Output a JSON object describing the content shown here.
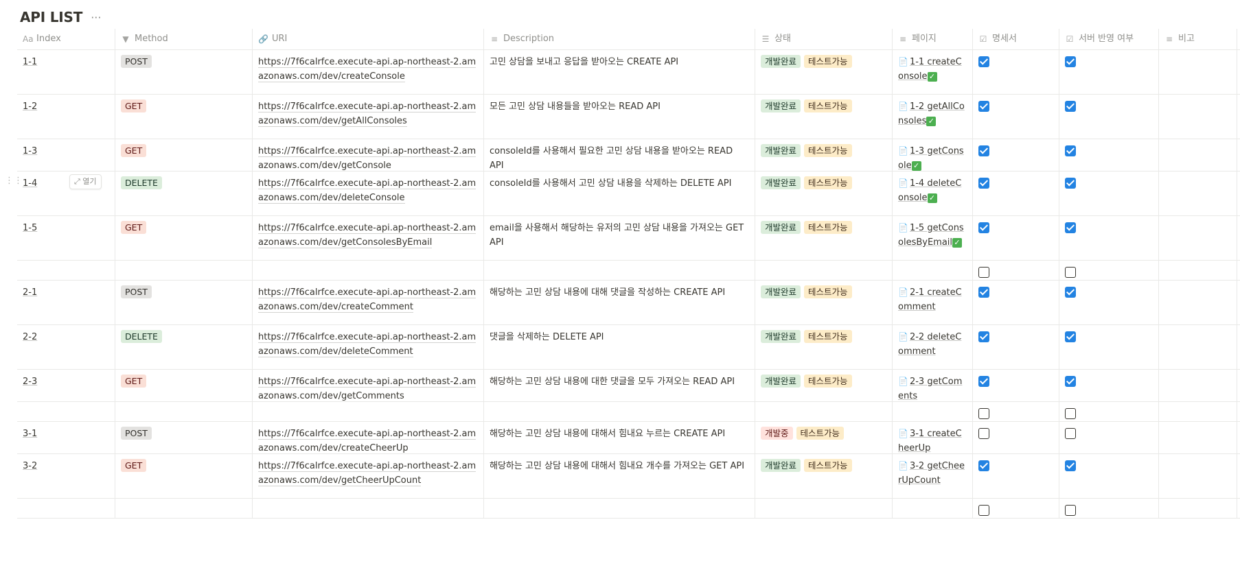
{
  "page": {
    "title": "API LIST",
    "more_icon": "more-horizontal-icon"
  },
  "columns": [
    {
      "key": "index",
      "label": "Index",
      "icon": "Aa"
    },
    {
      "key": "method",
      "label": "Method",
      "icon": "▼"
    },
    {
      "key": "uri",
      "label": "URI",
      "icon": "🔗"
    },
    {
      "key": "description",
      "label": "Description",
      "icon": "≡"
    },
    {
      "key": "status",
      "label": "상태",
      "icon": "☰"
    },
    {
      "key": "page",
      "label": "페이지",
      "icon": "≡"
    },
    {
      "key": "spec",
      "label": "명세서",
      "icon": "☑"
    },
    {
      "key": "server",
      "label": "서버 반영 여부",
      "icon": "☑"
    },
    {
      "key": "note",
      "label": "비고",
      "icon": "≡"
    }
  ],
  "open_button_label": "열기",
  "colors": {
    "accent_checkbox": "#2383e2",
    "tag_post": "#e3e2e0",
    "tag_get": "#fadfd6",
    "tag_delete": "#dbeddb",
    "status_done": "#dbeddb",
    "status_in_progress": "#ffe2dd",
    "status_testable": "#fdecc8"
  },
  "rows": [
    {
      "index": "1-1",
      "method": "POST",
      "uri": "https://7f6calrfce.execute-api.ap-northeast-2.amazonaws.com/dev/createConsole",
      "description": "고민 상담을 보내고 응답을 받아오는 CREATE API",
      "status": [
        "개발완료",
        "테스트가능"
      ],
      "page": "1-1 createConsole",
      "page_check": true,
      "spec": true,
      "server": true,
      "height": 65
    },
    {
      "index": "1-2",
      "method": "GET",
      "uri": "https://7f6calrfce.execute-api.ap-northeast-2.amazonaws.com/dev/getAllConsoles",
      "description": "모든 고민 상담 내용들을 받아오는 READ API",
      "status": [
        "개발완료",
        "테스트가능"
      ],
      "page": "1-2 getAllConsoles",
      "page_check": true,
      "spec": true,
      "server": true,
      "height": 65
    },
    {
      "index": "1-3",
      "method": "GET",
      "uri": "https://7f6calrfce.execute-api.ap-northeast-2.amazonaws.com/dev/getConsole",
      "description": "consoleId를 사용해서 필요한 고민 상담 내용을 받아오는 READ API",
      "status": [
        "개발완료",
        "테스트가능"
      ],
      "page": "1-3 getConsole",
      "page_check": true,
      "spec": true,
      "server": true,
      "height": 47
    },
    {
      "index": "1-4",
      "method": "DELETE",
      "uri": "https://7f6calrfce.execute-api.ap-northeast-2.amazonaws.com/dev/deleteConsole",
      "description": "consoleId를 사용해서 고민 상담 내용을 삭제하는 DELETE API",
      "status": [
        "개발완료",
        "테스트가능"
      ],
      "page": "1-4 deleteConsole",
      "page_check": true,
      "spec": true,
      "server": true,
      "height": 65,
      "hover": true
    },
    {
      "index": "1-5",
      "method": "GET",
      "uri": "https://7f6calrfce.execute-api.ap-northeast-2.amazonaws.com/dev/getConsolesByEmail",
      "description": "email을 사용해서 해당하는 유저의 고민 상담 내용을 가져오는 GET API",
      "status": [
        "개발완료",
        "테스트가능"
      ],
      "page": "1-5 getConsolesByEmail",
      "page_check": true,
      "spec": true,
      "server": true,
      "height": 65
    },
    {
      "index": "",
      "method": "",
      "uri": "",
      "description": "",
      "status": [],
      "page": "",
      "page_check": false,
      "spec": false,
      "server": false,
      "height": 29
    },
    {
      "index": "2-1",
      "method": "POST",
      "uri": "https://7f6calrfce.execute-api.ap-northeast-2.amazonaws.com/dev/createComment",
      "description": "해당하는 고민 상담 내용에 대해 댓글을 작성하는 CREATE API",
      "status": [
        "개발완료",
        "테스트가능"
      ],
      "page": "2-1 createComment",
      "page_check": false,
      "spec": true,
      "server": true,
      "height": 65
    },
    {
      "index": "2-2",
      "method": "DELETE",
      "uri": "https://7f6calrfce.execute-api.ap-northeast-2.amazonaws.com/dev/deleteComment",
      "description": "댓글을 삭제하는 DELETE API",
      "status": [
        "개발완료",
        "테스트가능"
      ],
      "page": "2-2 deleteComment",
      "page_check": false,
      "spec": true,
      "server": true,
      "height": 65
    },
    {
      "index": "2-3",
      "method": "GET",
      "uri": "https://7f6calrfce.execute-api.ap-northeast-2.amazonaws.com/dev/getComments",
      "description": "해당하는 고민 상담 내용에 대한 댓글을 모두 가져오는 READ API",
      "status": [
        "개발완료",
        "테스트가능"
      ],
      "page": "2-3 getComents",
      "page_check": false,
      "spec": true,
      "server": true,
      "height": 47
    },
    {
      "index": "",
      "method": "",
      "uri": "",
      "description": "",
      "status": [],
      "page": "",
      "page_check": false,
      "spec": false,
      "server": false,
      "height": 29
    },
    {
      "index": "3-1",
      "method": "POST",
      "uri": "https://7f6calrfce.execute-api.ap-northeast-2.amazonaws.com/dev/createCheerUp",
      "description": "해당하는 고민 상담 내용에 대해서 힘내요 누르는 CREATE API",
      "status": [
        "개발중",
        "테스트가능"
      ],
      "page": "3-1 createCheerUp",
      "page_check": false,
      "spec": false,
      "server": false,
      "height": 47
    },
    {
      "index": "3-2",
      "method": "GET",
      "uri": "https://7f6calrfce.execute-api.ap-northeast-2.amazonaws.com/dev/getCheerUpCount",
      "description": "해당하는 고민 상담 내용에 대해서 힘내요 개수를 가져오는 GET API",
      "status": [
        "개발완료",
        "테스트가능"
      ],
      "page": "3-2 getCheerUpCount",
      "page_check": false,
      "spec": true,
      "server": true,
      "height": 65
    },
    {
      "index": "",
      "method": "",
      "uri": "",
      "description": "",
      "status": [],
      "page": "",
      "page_check": false,
      "spec": false,
      "server": false,
      "height": 29
    }
  ]
}
